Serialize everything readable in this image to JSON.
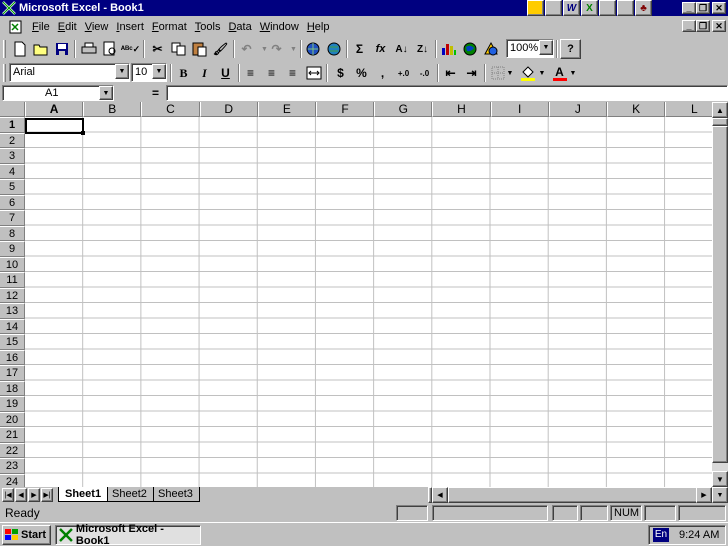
{
  "window": {
    "title": "Microsoft Excel - Book1",
    "minimize": "_",
    "restore": "❐",
    "close": "✕"
  },
  "officebar": [
    "",
    "",
    "W",
    "X",
    "",
    "",
    ""
  ],
  "menu": [
    "File",
    "Edit",
    "View",
    "Insert",
    "Format",
    "Tools",
    "Data",
    "Window",
    "Help"
  ],
  "standard_toolbar": {
    "zoom": "100%",
    "buttons": [
      "new-icon",
      "open-icon",
      "save-icon",
      "print-icon",
      "print-preview-icon",
      "spelling-icon",
      "cut-icon",
      "copy-icon",
      "paste-icon",
      "format-painter-icon",
      "undo-icon",
      "redo-icon",
      "hyperlink-icon",
      "web-toolbar-icon",
      "autosum-icon",
      "function-icon",
      "sort-ascending-icon",
      "sort-descending-icon",
      "chart-wizard-icon",
      "map-icon",
      "drawing-icon",
      "help-icon"
    ],
    "glyphs": {
      "autosum": "Σ",
      "function": "fx",
      "sort_asc": "A↓",
      "sort_desc": "Z↓",
      "help": "?"
    }
  },
  "formatting_toolbar": {
    "font": "Arial",
    "size": "10",
    "bold": "B",
    "italic": "I",
    "underline": "U",
    "currency": "$",
    "percent": "%",
    "comma": ",",
    "inc_decimal": "+.0",
    "dec_decimal": "-.0",
    "font_color": "A"
  },
  "formula_bar": {
    "name_box": "A1",
    "equals": "=",
    "formula": ""
  },
  "grid": {
    "columns": [
      "A",
      "B",
      "C",
      "D",
      "E",
      "F",
      "G",
      "H",
      "I",
      "J",
      "K",
      "L"
    ],
    "rows": [
      "1",
      "2",
      "3",
      "4",
      "5",
      "6",
      "7",
      "8",
      "9",
      "10",
      "11",
      "12",
      "13",
      "14",
      "15",
      "16",
      "17",
      "18",
      "19",
      "20",
      "21",
      "22",
      "23",
      "24"
    ],
    "active_cell": "A1"
  },
  "sheets": [
    "Sheet1",
    "Sheet2",
    "Sheet3"
  ],
  "active_sheet": "Sheet1",
  "status": {
    "text": "Ready",
    "num": "NUM"
  },
  "taskbar": {
    "start": "Start",
    "item": "Microsoft Excel - Book1",
    "lang": "En",
    "clock": "9:24 AM"
  },
  "colors": {
    "titlebar": "#000080",
    "face": "#c0c0c0",
    "grid": "#c0c0c0"
  }
}
